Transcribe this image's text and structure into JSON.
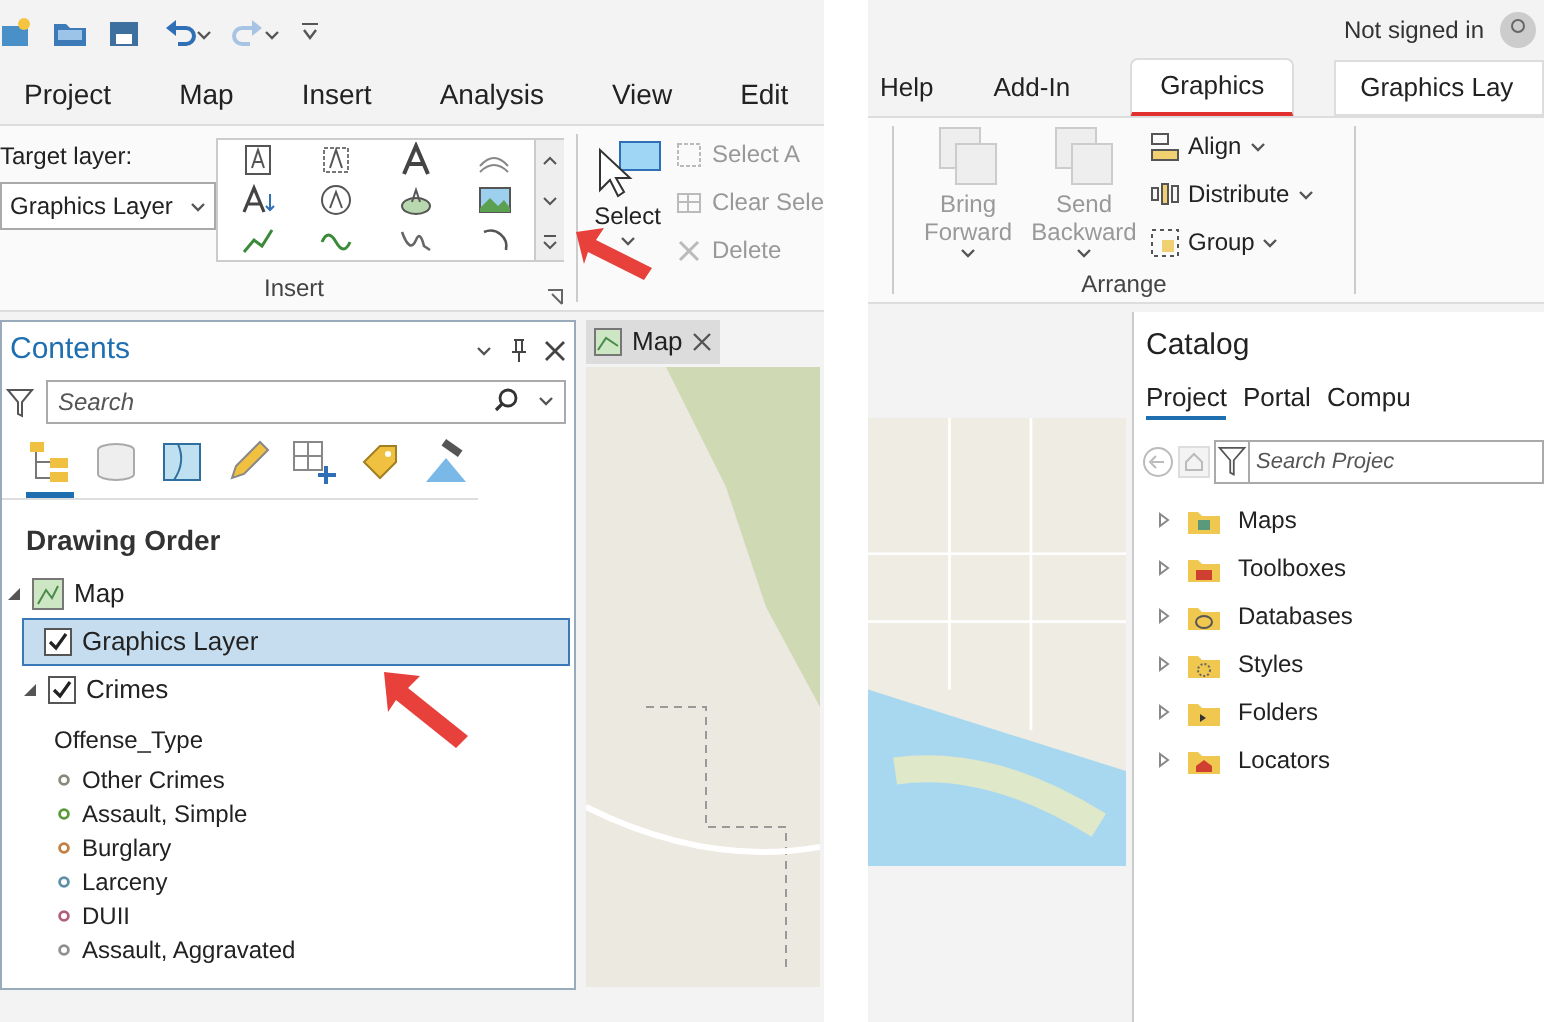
{
  "left": {
    "tabs": [
      {
        "label": "Project",
        "selected": false
      },
      {
        "label": "Map",
        "selected": false
      },
      {
        "label": "Insert",
        "selected": false
      },
      {
        "label": "Analysis",
        "selected": false
      },
      {
        "label": "View",
        "selected": false
      },
      {
        "label": "Edit",
        "selected": false
      }
    ],
    "target_layer": {
      "label": "Target layer:",
      "value": "Graphics Layer"
    },
    "insert_group": {
      "label": "Insert"
    },
    "select_button": {
      "label": "Select"
    },
    "small_buttons": [
      "Select A",
      "Clear Sele",
      "Delete"
    ],
    "contents": {
      "title": "Contents",
      "search": {
        "placeholder": "Search"
      },
      "view_tabs": [
        {
          "selected": true
        },
        {
          "selected": false
        },
        {
          "selected": false
        },
        {
          "selected": false
        },
        {
          "selected": false
        },
        {
          "selected": false
        },
        {
          "selected": false
        }
      ],
      "heading": "Drawing Order",
      "tree": [
        {
          "label": "Map",
          "expanded": true,
          "children": [
            {
              "label": "Graphics Layer",
              "checked": true,
              "selected": true
            },
            {
              "label": "Crimes",
              "checked": true,
              "selected": false,
              "expanded": true,
              "legend_title": "Offense_Type",
              "classes": [
                {
                  "label": "Other Crimes",
                  "color": "#8a8a78"
                },
                {
                  "label": "Assault, Simple",
                  "color": "#5a9a3a"
                },
                {
                  "label": "Burglary",
                  "color": "#c08040"
                },
                {
                  "label": "Larceny",
                  "color": "#5f8fa8"
                },
                {
                  "label": "DUII",
                  "color": "#b0607a"
                },
                {
                  "label": "Assault, Aggravated",
                  "color": "#909090"
                }
              ]
            }
          ]
        }
      ]
    },
    "map_tab": {
      "label": "Map"
    }
  },
  "right": {
    "account": "Not signed in",
    "tabs": [
      {
        "label": "Help",
        "selected": false
      },
      {
        "label": "Add-In",
        "selected": false
      },
      {
        "label": "Graphics",
        "selected": true
      }
    ],
    "contextual_tab": {
      "label": "Graphics Lay"
    },
    "arrange": {
      "label": "Arrange",
      "big_buttons": [
        "Bring Forward",
        "Send Backward"
      ],
      "menu_buttons": [
        "Align",
        "Distribute",
        "Group"
      ]
    },
    "catalog": {
      "title": "Catalog",
      "tabs": [
        {
          "label": "Project",
          "selected": true
        },
        {
          "label": "Portal",
          "selected": false
        },
        {
          "label": "Compu",
          "selected": false
        }
      ],
      "search": {
        "placeholder": "Search Projec"
      },
      "items": [
        "Maps",
        "Toolboxes",
        "Databases",
        "Styles",
        "Folders",
        "Locators"
      ]
    }
  }
}
